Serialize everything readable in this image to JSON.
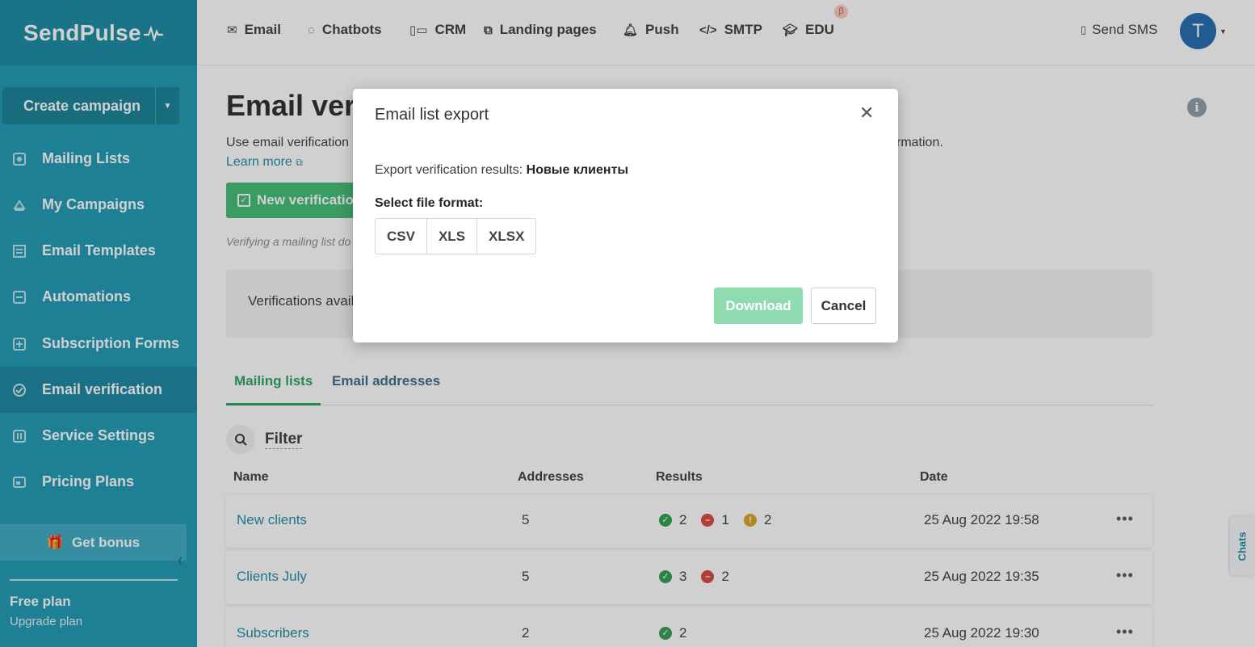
{
  "brand": {
    "name": "SendPulse"
  },
  "sidebar": {
    "create_campaign": "Create campaign",
    "items": [
      {
        "label": "Mailing Lists",
        "icon": "mailing-lists-icon"
      },
      {
        "label": "My Campaigns",
        "icon": "campaigns-icon"
      },
      {
        "label": "Email Templates",
        "icon": "templates-icon"
      },
      {
        "label": "Automations",
        "icon": "automations-icon"
      },
      {
        "label": "Subscription Forms",
        "icon": "forms-icon"
      },
      {
        "label": "Email verification",
        "icon": "verification-icon",
        "active": true
      },
      {
        "label": "Service Settings",
        "icon": "settings-icon"
      },
      {
        "label": "Pricing Plans",
        "icon": "pricing-icon"
      }
    ],
    "bonus": "Get bonus",
    "plan": "Free plan",
    "upgrade": "Upgrade plan"
  },
  "topnav": {
    "items": [
      "Email",
      "Chatbots",
      "CRM",
      "Landing pages",
      "Push",
      "SMTP",
      "EDU"
    ],
    "beta": "β",
    "send_sms": "Send SMS",
    "avatar_letter": "T"
  },
  "main": {
    "title": "Email veri",
    "desc_left": "Use email verification",
    "desc_right": "rmation.",
    "learn_more": "Learn more",
    "new_verification": "New verificatio",
    "verify_note": "Verifying a mailing list do",
    "available": "Verifications avail",
    "tabs": [
      "Mailing lists",
      "Email addresses"
    ],
    "filter": "Filter",
    "columns": [
      "Name",
      "Addresses",
      "Results",
      "Date"
    ],
    "rows": [
      {
        "name": "New clients",
        "addresses": "5",
        "valid": "2",
        "invalid": "1",
        "risky": "2",
        "date": "25 Aug 2022 19:58"
      },
      {
        "name": "Clients July",
        "addresses": "5",
        "valid": "3",
        "invalid": "2",
        "date": "25 Aug 2022 19:35"
      },
      {
        "name": "Subscribers",
        "addresses": "2",
        "valid": "2",
        "date": "25 Aug 2022 19:30"
      }
    ]
  },
  "chats_tab": "Chats",
  "modal": {
    "title": "Email list export",
    "export_prefix": "Export verification results:",
    "list_name": "Новые клиенты",
    "select_format": "Select file format:",
    "formats": [
      "CSV",
      "XLS",
      "XLSX"
    ],
    "download": "Download",
    "cancel": "Cancel"
  },
  "colors": {
    "sidebar": "#1b99b3",
    "accent_green": "#3fbd73",
    "link": "#1b89a8",
    "download_disabled": "#8edbb0"
  }
}
